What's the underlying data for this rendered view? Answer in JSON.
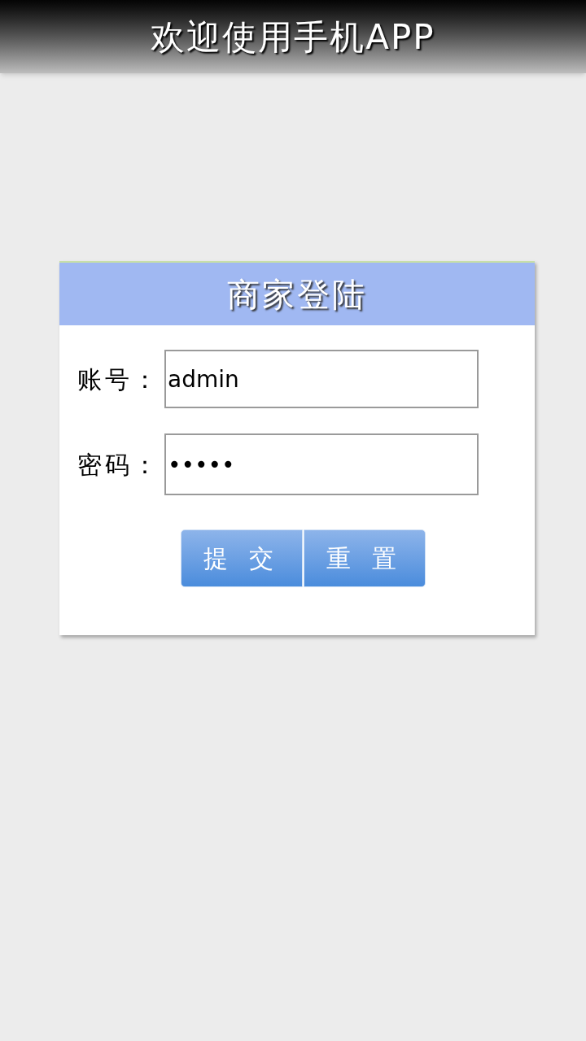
{
  "header": {
    "title": "欢迎使用手机APP"
  },
  "login_card": {
    "title": "商家登陆",
    "fields": [
      {
        "label": "账号：",
        "value": "admin"
      },
      {
        "label": "密码：",
        "value": "•••••"
      }
    ],
    "buttons": [
      "提 交",
      "重 置"
    ]
  }
}
